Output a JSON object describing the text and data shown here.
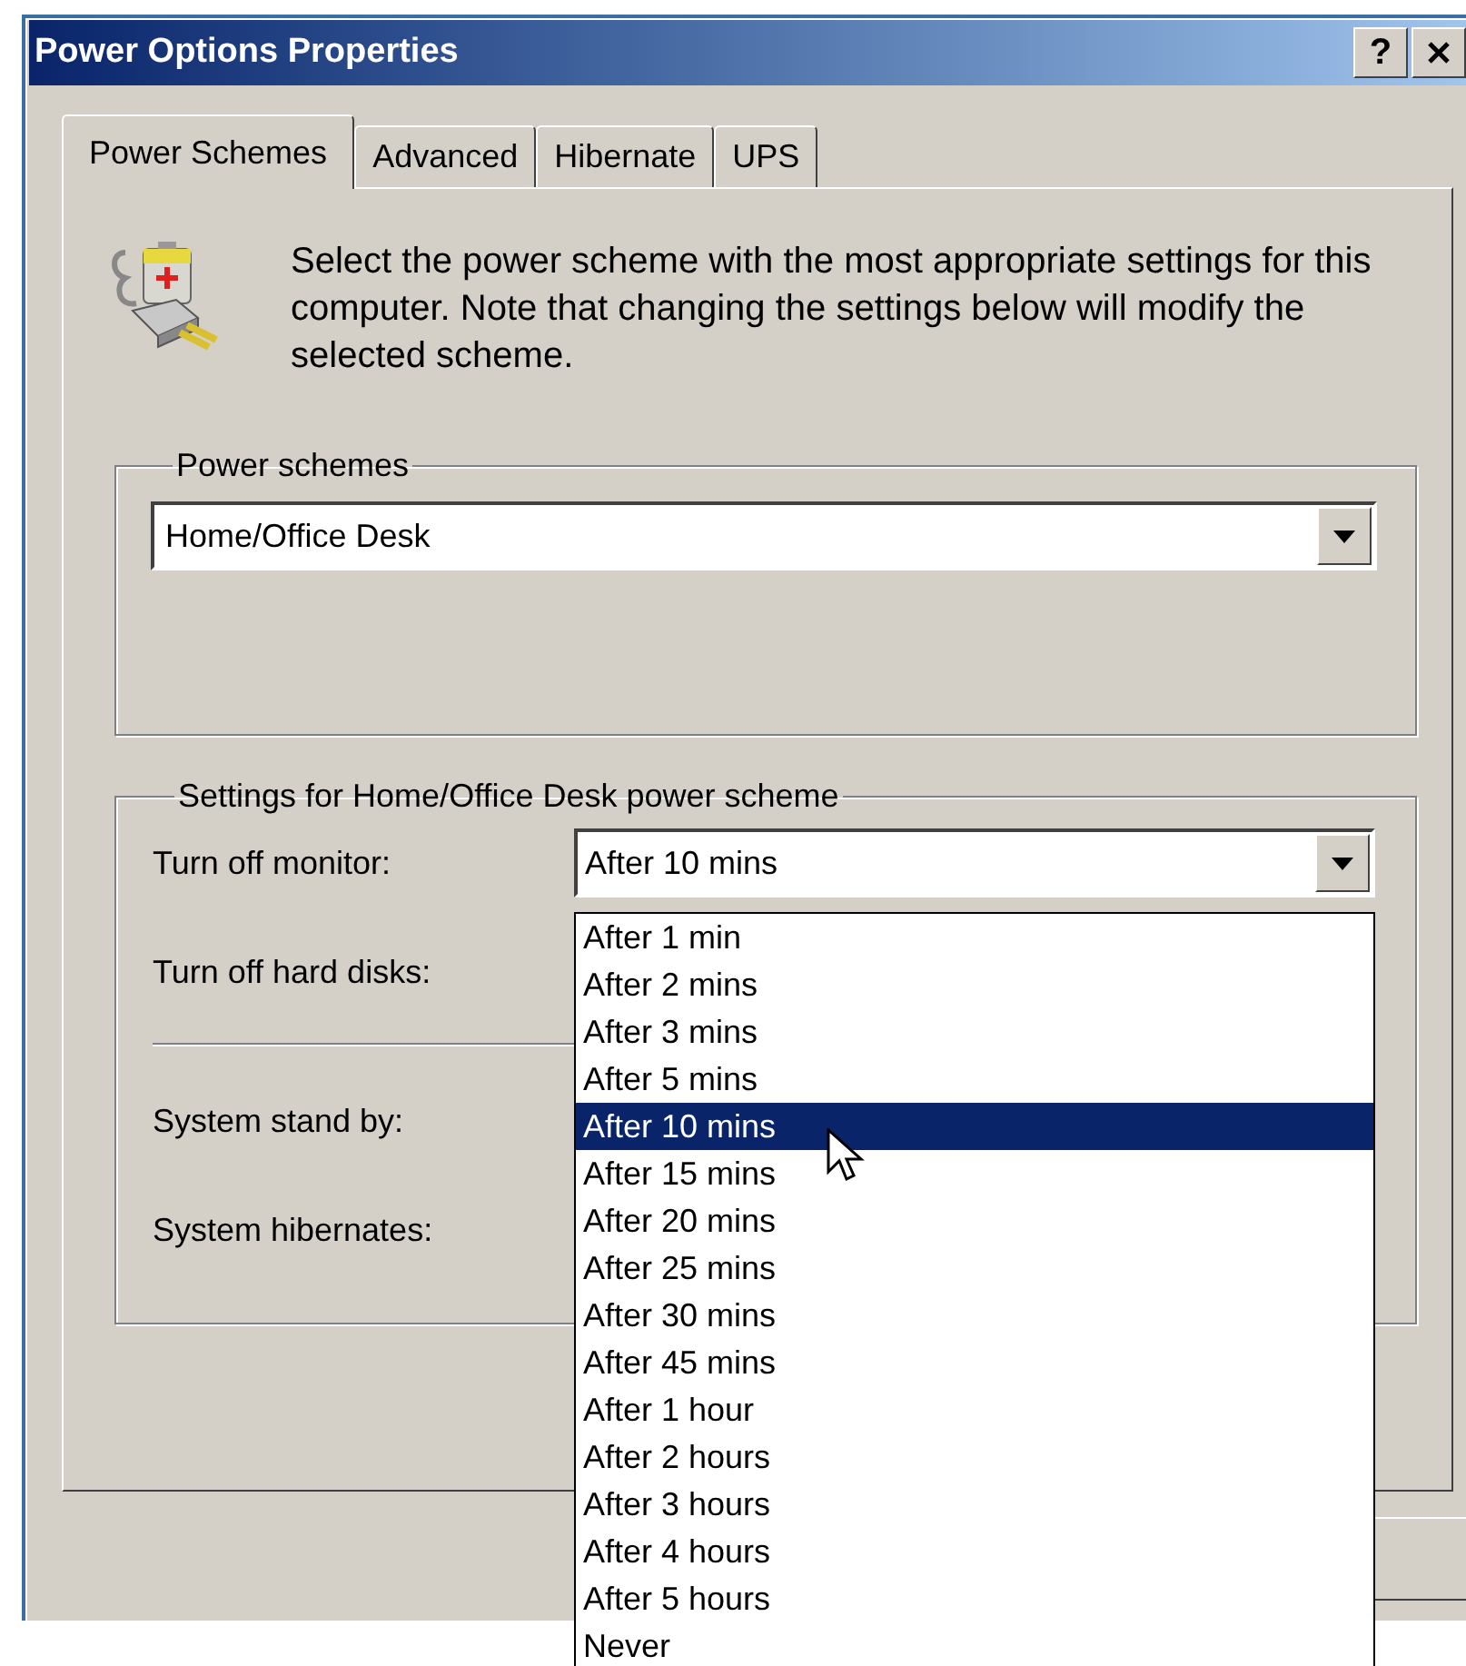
{
  "window": {
    "title": "Power Options Properties",
    "help_button": "?"
  },
  "tabs": [
    {
      "label": "Power Schemes",
      "selected": true
    },
    {
      "label": "Advanced",
      "selected": false
    },
    {
      "label": "Hibernate",
      "selected": false
    },
    {
      "label": "UPS",
      "selected": false
    }
  ],
  "description": "Select the power scheme with the most appropriate settings for this computer. Note that changing the settings below will modify the selected scheme.",
  "power_schemes": {
    "legend": "Power schemes",
    "value": "Home/Office Desk"
  },
  "settings": {
    "legend": "Settings for Home/Office Desk power scheme",
    "rows": [
      {
        "label": "Turn off monitor:",
        "value": "After 10 mins",
        "expanded": true
      },
      {
        "label": "Turn off hard disks:",
        "divider_after": true
      },
      {
        "label": "System stand by:"
      },
      {
        "label": "System hibernates:"
      }
    ]
  },
  "dropdown_options": [
    {
      "label": "After 1 min",
      "selected": false
    },
    {
      "label": "After 2 mins",
      "selected": false
    },
    {
      "label": "After 3 mins",
      "selected": false
    },
    {
      "label": "After 5 mins",
      "selected": false
    },
    {
      "label": "After 10 mins",
      "selected": true
    },
    {
      "label": "After 15 mins",
      "selected": false
    },
    {
      "label": "After 20 mins",
      "selected": false
    },
    {
      "label": "After 25 mins",
      "selected": false
    },
    {
      "label": "After 30 mins",
      "selected": false
    },
    {
      "label": "After 45 mins",
      "selected": false
    },
    {
      "label": "After 1 hour",
      "selected": false
    },
    {
      "label": "After 2 hours",
      "selected": false
    },
    {
      "label": "After 3 hours",
      "selected": false
    },
    {
      "label": "After 4 hours",
      "selected": false
    },
    {
      "label": "After 5 hours",
      "selected": false
    },
    {
      "label": "Never",
      "selected": false
    }
  ]
}
